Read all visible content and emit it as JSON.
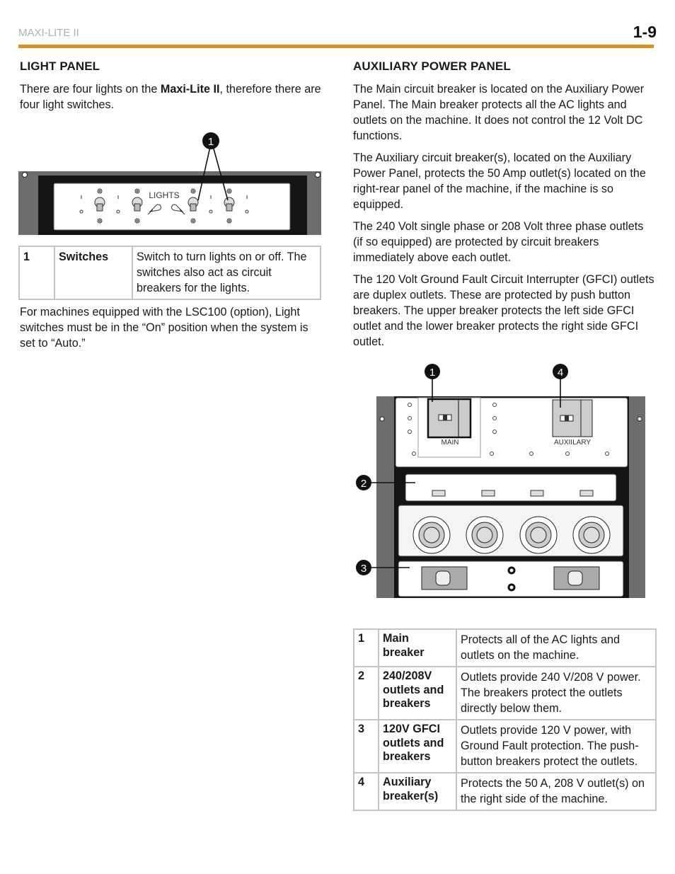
{
  "header": {
    "doc_title": "MAXI-LITE II",
    "page_number": "1-9",
    "rule_color": "#d9901f"
  },
  "light_panel": {
    "heading": "LIGHT PANEL",
    "intro_before": "There are four lights on the ",
    "intro_bold": "Maxi-Lite II",
    "intro_after": ", therefore there are four light switches.",
    "figure": {
      "panel_label": "LIGHTS",
      "callout": "1"
    },
    "key": [
      {
        "num": "1",
        "term": "Switches",
        "desc": "Switch to turn lights on or off. The switches also act as circuit breakers for the lights."
      }
    ],
    "note": "For machines equipped with the LSC100 (option), Light switches must be in the “On” position when the system is set to “Auto.”"
  },
  "aux_panel": {
    "heading": "AUXILIARY POWER PANEL",
    "paragraphs": [
      "The Main circuit breaker is located on the Auxiliary Power Panel. The Main breaker protects all the AC lights and outlets on the machine. It does not control the 12 Volt DC functions.",
      "The Auxiliary circuit breaker(s), located on the Auxiliary Power Panel, protects the 50 Amp outlet(s) located on the right-rear panel of the machine, if the machine is so equipped.",
      "The 240 Volt single phase or 208 Volt three phase outlets (if so equipped) are protected by circuit breakers immediately above each outlet.",
      "The 120 Volt Ground Fault Circuit Interrupter (GFCI) outlets are duplex outlets. These are protected by push button breakers. The upper breaker protects the left side GFCI outlet and the lower breaker protects the right side GFCI outlet."
    ],
    "figure": {
      "main_label": "MAIN",
      "aux_label": "AUXIILARY",
      "callouts": [
        "1",
        "4",
        "2",
        "3"
      ]
    },
    "key": [
      {
        "num": "1",
        "term": "Main breaker",
        "desc": "Protects all of the AC lights and outlets on the machine."
      },
      {
        "num": "2",
        "term": "240/208V outlets and breakers",
        "desc": "Outlets provide 240 V/208 V power. The breakers protect the outlets directly below them."
      },
      {
        "num": "3",
        "term": "120V GFCI outlets and breakers",
        "desc": "Outlets provide 120 V power, with Ground Fault protection. The push-button breakers protect the outlets."
      },
      {
        "num": "4",
        "term": "Auxiliary breaker(s)",
        "desc": "Protects the 50 A, 208 V outlet(s) on the right side of the machine."
      }
    ]
  }
}
